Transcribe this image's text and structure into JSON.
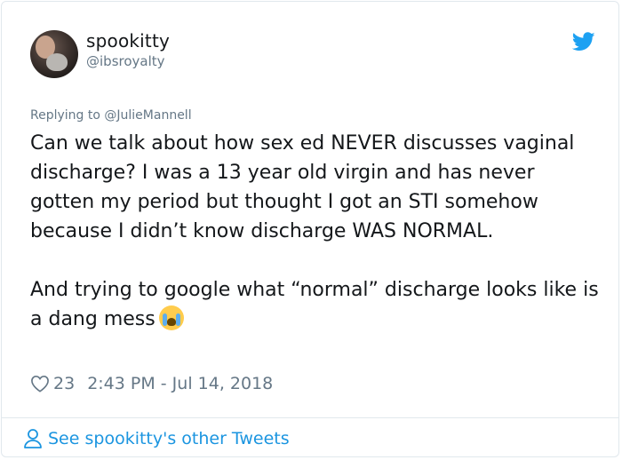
{
  "user": {
    "display_name": "spookitty",
    "handle": "@ibsroyalty"
  },
  "reply": {
    "prefix": "Replying to ",
    "mention": "@JulieMannell"
  },
  "tweet": {
    "text": "Can we talk about how sex ed NEVER discusses vaginal discharge? I was a 13 year old virgin and has never gotten my period but thought I got an STI somehow because I didn’t know discharge WAS NORMAL.\n\nAnd trying to google what “normal” discharge looks like is a dang mess",
    "emoji": "loudly-crying-face"
  },
  "meta": {
    "likes": "23",
    "timestamp": "2:43 PM - Jul 14, 2018"
  },
  "footer": {
    "link_label": "See spookitty's other Tweets"
  },
  "colors": {
    "brand_blue": "#1da1f2",
    "link_blue": "#1b95e0",
    "muted_gray": "#657786",
    "text_dark": "#14171a"
  },
  "icons": [
    "twitter-bird-icon",
    "heart-icon",
    "person-icon"
  ]
}
